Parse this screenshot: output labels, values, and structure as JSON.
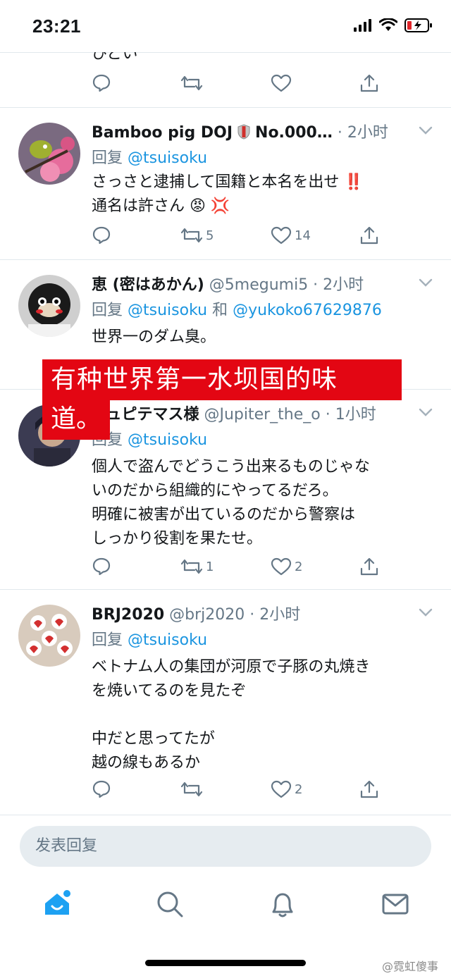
{
  "status_bar": {
    "time": "23:21"
  },
  "cut_tweet": {
    "text": "ひどい"
  },
  "tweets": [
    {
      "name": "Bamboo pig DOJ",
      "name_suffix": " No.000…",
      "handle": "",
      "sep": " · ",
      "time": "2小时",
      "reply_prefix": "回复 ",
      "reply_to": "@tsuisoku",
      "reply_join": "",
      "reply_to2": "",
      "body": "さっさと逮捕して国籍と本名を出せ ‼️\n通名は許さん 😡 💢",
      "counts": {
        "reply": "",
        "retweet": "5",
        "like": "14"
      }
    },
    {
      "name": "恵 (密はあかん)",
      "name_suffix": "",
      "handle": " @5megumi5",
      "sep": " · ",
      "time": "2小时",
      "reply_prefix": "回复 ",
      "reply_to": "@tsuisoku",
      "reply_join": " 和 ",
      "reply_to2": "@yukoko67629876",
      "body": "世界一のダム臭。",
      "counts": {
        "reply": "",
        "retweet": "",
        "like": ""
      }
    },
    {
      "name": "ジュピテマス様",
      "name_suffix": "",
      "handle": " @Jupiter_the_o",
      "sep": " · ",
      "time": "1小时",
      "reply_prefix": "回复 ",
      "reply_to": "@tsuisoku",
      "reply_join": "",
      "reply_to2": "",
      "body": "個人で盗んでどうこう出来るものじゃな\nいのだから組織的にやってるだろ。\n明確に被害が出ているのだから警察は\nしっかり役割を果たせ。",
      "counts": {
        "reply": "",
        "retweet": "1",
        "like": "2"
      }
    },
    {
      "name": "BRJ2020",
      "name_suffix": "",
      "handle": " @brj2020",
      "sep": " · ",
      "time": "2小时",
      "reply_prefix": "回复 ",
      "reply_to": "@tsuisoku",
      "reply_join": "",
      "reply_to2": "",
      "body": "ベトナム人の集団が河原で子豚の丸焼き\nを焼いてるのを見たぞ\n\n中だと思ってたが\n越の線もあるか",
      "counts": {
        "reply": "",
        "retweet": "",
        "like": "2"
      }
    }
  ],
  "overlay_caption": {
    "line1": "有种世界第一水坝国的味",
    "line2": "道。"
  },
  "compose": {
    "placeholder": "发表回复"
  },
  "watermark": "@霓虹傻事",
  "colors": {
    "link": "#1b95e0",
    "muted": "#657786",
    "accent": "#1da1f2",
    "caption_bg": "#e30613"
  }
}
